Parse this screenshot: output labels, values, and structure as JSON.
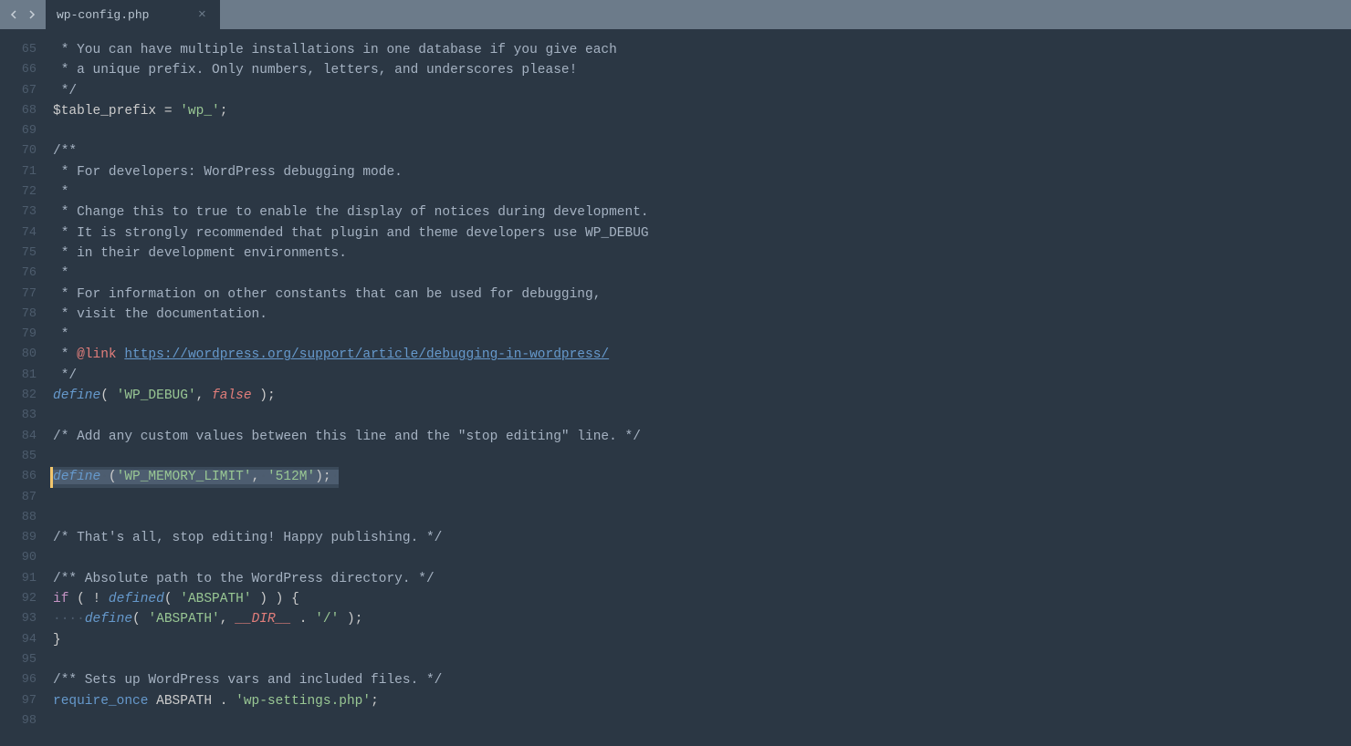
{
  "tab": {
    "title": "wp-config.php"
  },
  "gutter": {
    "start": 65,
    "end": 98
  },
  "code": {
    "lines": [
      {
        "n": 65,
        "html": "<span class='c-comment'> * You can have multiple installations in one database if you give each</span>"
      },
      {
        "n": 66,
        "html": "<span class='c-comment'> * a unique prefix. Only numbers, letters, and underscores please!</span>"
      },
      {
        "n": 67,
        "html": "<span class='c-comment'> */</span>"
      },
      {
        "n": 68,
        "html": "<span class='c-var'>$table_prefix</span> <span class='c-op'>=</span> <span class='c-string'>'wp_'</span><span class='c-white'>;</span>"
      },
      {
        "n": 69,
        "html": ""
      },
      {
        "n": 70,
        "html": "<span class='c-comment'>/**</span>"
      },
      {
        "n": 71,
        "html": "<span class='c-comment'> * For developers: WordPress debugging mode.</span>"
      },
      {
        "n": 72,
        "html": "<span class='c-comment'> *</span>"
      },
      {
        "n": 73,
        "html": "<span class='c-comment'> * Change this to true to enable the display of notices during development.</span>"
      },
      {
        "n": 74,
        "html": "<span class='c-comment'> * It is strongly recommended that plugin and theme developers use WP_DEBUG</span>"
      },
      {
        "n": 75,
        "html": "<span class='c-comment'> * in their development environments.</span>"
      },
      {
        "n": 76,
        "html": "<span class='c-comment'> *</span>"
      },
      {
        "n": 77,
        "html": "<span class='c-comment'> * For information on other constants that can be used for debugging,</span>"
      },
      {
        "n": 78,
        "html": "<span class='c-comment'> * visit the documentation.</span>"
      },
      {
        "n": 79,
        "html": "<span class='c-comment'> *</span>"
      },
      {
        "n": 80,
        "html": "<span class='c-comment'> * </span><span class='c-doctag'>@link</span><span class='c-comment'> </span><span class='c-link'>https://wordpress.org/support/article/debugging-in-wordpress/</span>"
      },
      {
        "n": 81,
        "html": "<span class='c-comment'> */</span>"
      },
      {
        "n": 82,
        "html": "<span class='c-keyword'>define</span><span class='c-white'>( </span><span class='c-string'>'WP_DEBUG'</span><span class='c-white'>, </span><span class='c-const'>false</span><span class='c-white'> );</span>"
      },
      {
        "n": 83,
        "html": ""
      },
      {
        "n": 84,
        "html": "<span class='c-comment'>/* Add any custom values between this line and the \"stop editing\" line. */</span>"
      },
      {
        "n": 85,
        "html": ""
      },
      {
        "n": 86,
        "html": "",
        "highlighted": true,
        "special": "define_memory"
      },
      {
        "n": 87,
        "html": ""
      },
      {
        "n": 88,
        "html": ""
      },
      {
        "n": 89,
        "html": "<span class='c-comment'>/* That's all, stop editing! Happy publishing. */</span>"
      },
      {
        "n": 90,
        "html": ""
      },
      {
        "n": 91,
        "html": "<span class='c-comment'>/** Absolute path to the WordPress directory. */</span>"
      },
      {
        "n": 92,
        "html": "<span class='c-keyword2'>if</span><span class='c-white'> ( </span><span class='c-op'>!</span><span class='c-white'> </span><span class='c-keyword'>defined</span><span class='c-white'>( </span><span class='c-string'>'ABSPATH'</span><span class='c-white'> ) ) {</span>"
      },
      {
        "n": 93,
        "html": "<span class='dim-dot'>····</span><span class='c-keyword'>define</span><span class='c-white'>( </span><span class='c-string'>'ABSPATH'</span><span class='c-white'>, </span><span class='c-const'>__DIR__</span><span class='c-white'> </span><span class='c-op'>.</span><span class='c-white'> </span><span class='c-string'>'/'</span><span class='c-white'> );</span>"
      },
      {
        "n": 94,
        "html": "<span class='c-white'>}</span>"
      },
      {
        "n": 95,
        "html": ""
      },
      {
        "n": 96,
        "html": "<span class='c-comment'>/** Sets up WordPress vars and included files. */</span>"
      },
      {
        "n": 97,
        "html": "<span class='c-func'>require_once</span><span class='c-white'> </span><span class='c-constname'>ABSPATH</span><span class='c-white'> </span><span class='c-op'>.</span><span class='c-white'> </span><span class='c-string'>'wp-settings.php'</span><span class='c-white'>;</span>"
      },
      {
        "n": 98,
        "html": ""
      }
    ],
    "highlighted_line_tokens": {
      "define": "define",
      "open_tokens": "·(",
      "str1": "'WP_MEMORY_LIMIT'",
      "mid": ",·",
      "str2": "'512M'",
      "close": ");",
      "trail": "·"
    }
  }
}
